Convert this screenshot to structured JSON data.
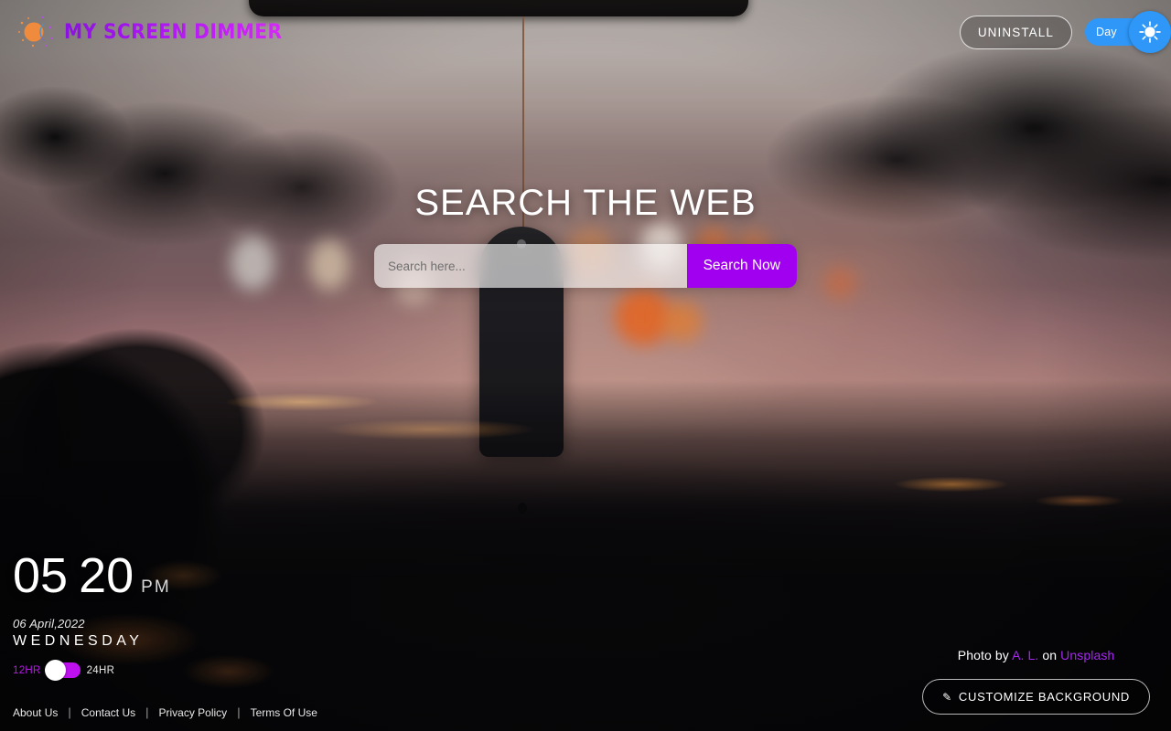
{
  "brand": {
    "name": "MY SCREEN DIMMER",
    "icon": "sun-moon-icon"
  },
  "header": {
    "uninstall_label": "UNINSTALL",
    "mode_toggle": {
      "label": "Day",
      "icon": "sun-icon",
      "state": "day",
      "track_color": "#2e97f7"
    }
  },
  "search": {
    "title": "SEARCH THE WEB",
    "placeholder": "Search here...",
    "value": "",
    "button_label": "Search Now",
    "button_color": "#a100f0"
  },
  "clock": {
    "hours": "05",
    "minutes": "20",
    "meridiem": "PM",
    "date": "06 April,2022",
    "weekday": "WEDNESDAY",
    "format_toggle": {
      "left_label": "12HR",
      "right_label": "24HR",
      "active": "12HR",
      "track_color": "#bf11f0"
    }
  },
  "footer": {
    "links": [
      {
        "label": "About Us"
      },
      {
        "label": "Contact Us"
      },
      {
        "label": "Privacy Policy"
      },
      {
        "label": "Terms Of Use"
      }
    ],
    "separator": "|"
  },
  "credit": {
    "prefix": "Photo by",
    "author": "A. L.",
    "middle": "on",
    "source": "Unsplash",
    "link_color": "#a726f0"
  },
  "customize": {
    "label": "CUSTOMIZE BACKGROUND",
    "icon": "pencil-icon",
    "icon_glyph": "✎"
  }
}
